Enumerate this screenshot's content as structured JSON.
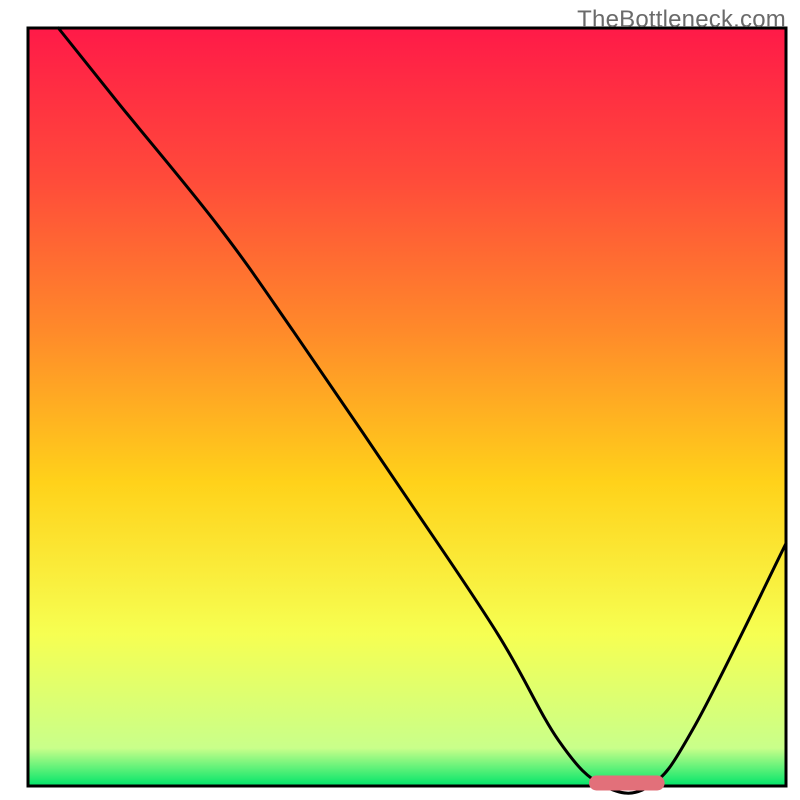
{
  "watermark": "TheBottleneck.com",
  "chart_data": {
    "type": "line",
    "title": "",
    "xlabel": "",
    "ylabel": "",
    "xlim": [
      0,
      100
    ],
    "ylim": [
      0,
      100
    ],
    "grid": false,
    "legend": false,
    "background_gradient": {
      "stops": [
        {
          "pos": 0.0,
          "color": "#ff1a48"
        },
        {
          "pos": 0.2,
          "color": "#ff4b3a"
        },
        {
          "pos": 0.4,
          "color": "#ff8a2a"
        },
        {
          "pos": 0.6,
          "color": "#ffd21a"
        },
        {
          "pos": 0.8,
          "color": "#f6ff52"
        },
        {
          "pos": 0.95,
          "color": "#c9ff8a"
        },
        {
          "pos": 1.0,
          "color": "#00e56a"
        }
      ]
    },
    "series": [
      {
        "name": "bottleneck-curve",
        "color": "#000000",
        "x": [
          4,
          12,
          25,
          35,
          50,
          62,
          70,
          76,
          82,
          88,
          100
        ],
        "y": [
          100,
          90,
          74,
          60,
          38,
          20,
          6,
          0,
          0,
          8,
          32
        ]
      }
    ],
    "marker": {
      "name": "optimal-segment",
      "color": "#e2707a",
      "x_start": 75,
      "x_end": 83,
      "y": 0,
      "thickness": 2.5
    },
    "frame": {
      "color": "#000000",
      "width": 3
    }
  }
}
